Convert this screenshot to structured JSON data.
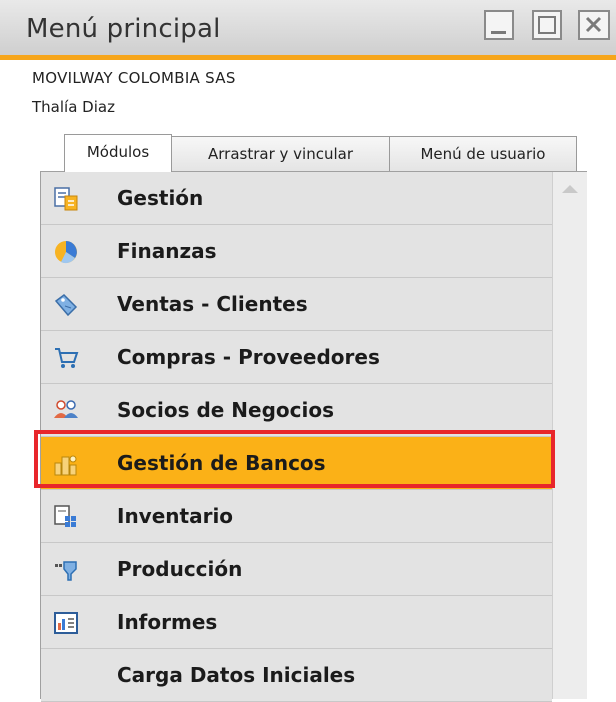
{
  "window": {
    "title": "Menú principal",
    "buttons": [
      "minimize",
      "maximize",
      "close"
    ]
  },
  "header": {
    "company": "MOVILWAY COLOMBIA SAS",
    "user": "Thalía Diaz"
  },
  "tabs": [
    {
      "label": "Módulos",
      "active": true
    },
    {
      "label": "Arrastrar y vincular",
      "active": false
    },
    {
      "label": "Menú de usuario",
      "active": false
    }
  ],
  "modules": [
    {
      "label": "Gestión",
      "icon": "gestion-icon"
    },
    {
      "label": "Finanzas",
      "icon": "finanzas-pie-icon"
    },
    {
      "label": "Ventas - Clientes",
      "icon": "ventas-tag-icon"
    },
    {
      "label": "Compras - Proveedores",
      "icon": "shopping-cart-icon"
    },
    {
      "label": "Socios de Negocios",
      "icon": "business-partners-icon"
    },
    {
      "label": "Gestión de Bancos",
      "icon": "banking-coins-icon",
      "selected": true
    },
    {
      "label": "Inventario",
      "icon": "inventory-icon"
    },
    {
      "label": "Producción",
      "icon": "production-icon"
    },
    {
      "label": "Informes",
      "icon": "reports-chart-icon"
    },
    {
      "label": "Carga Datos Iniciales",
      "icon": ""
    }
  ],
  "colors": {
    "accent": "#f6a51a",
    "selected": "#fbb117",
    "highlight_frame": "#e8262b"
  }
}
